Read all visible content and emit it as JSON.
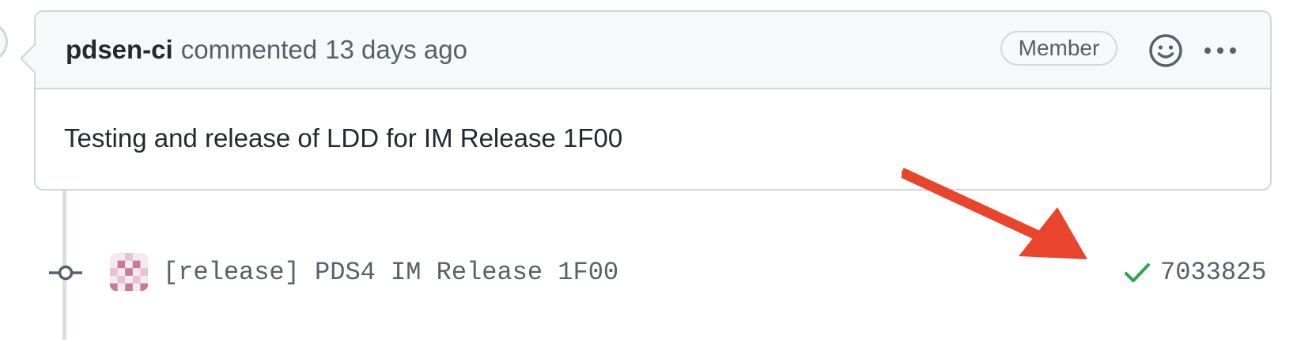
{
  "comment": {
    "author": "pdsen-ci",
    "action": "commented",
    "timestamp": "13 days ago",
    "badge": "Member",
    "body": "Testing and release of LDD for IM Release 1F00",
    "icons": {
      "reaction": "smiley-icon",
      "more": "kebab-horizontal-icon"
    }
  },
  "commit": {
    "message": "[release] PDS4 IM Release 1F00",
    "sha": "7033825",
    "status": "success",
    "status_color": "#2da44e",
    "node_icon": "git-commit-icon",
    "avatar_icon": "identicon-avatar"
  },
  "annotation": {
    "type": "arrow",
    "color": "#e8452c"
  }
}
